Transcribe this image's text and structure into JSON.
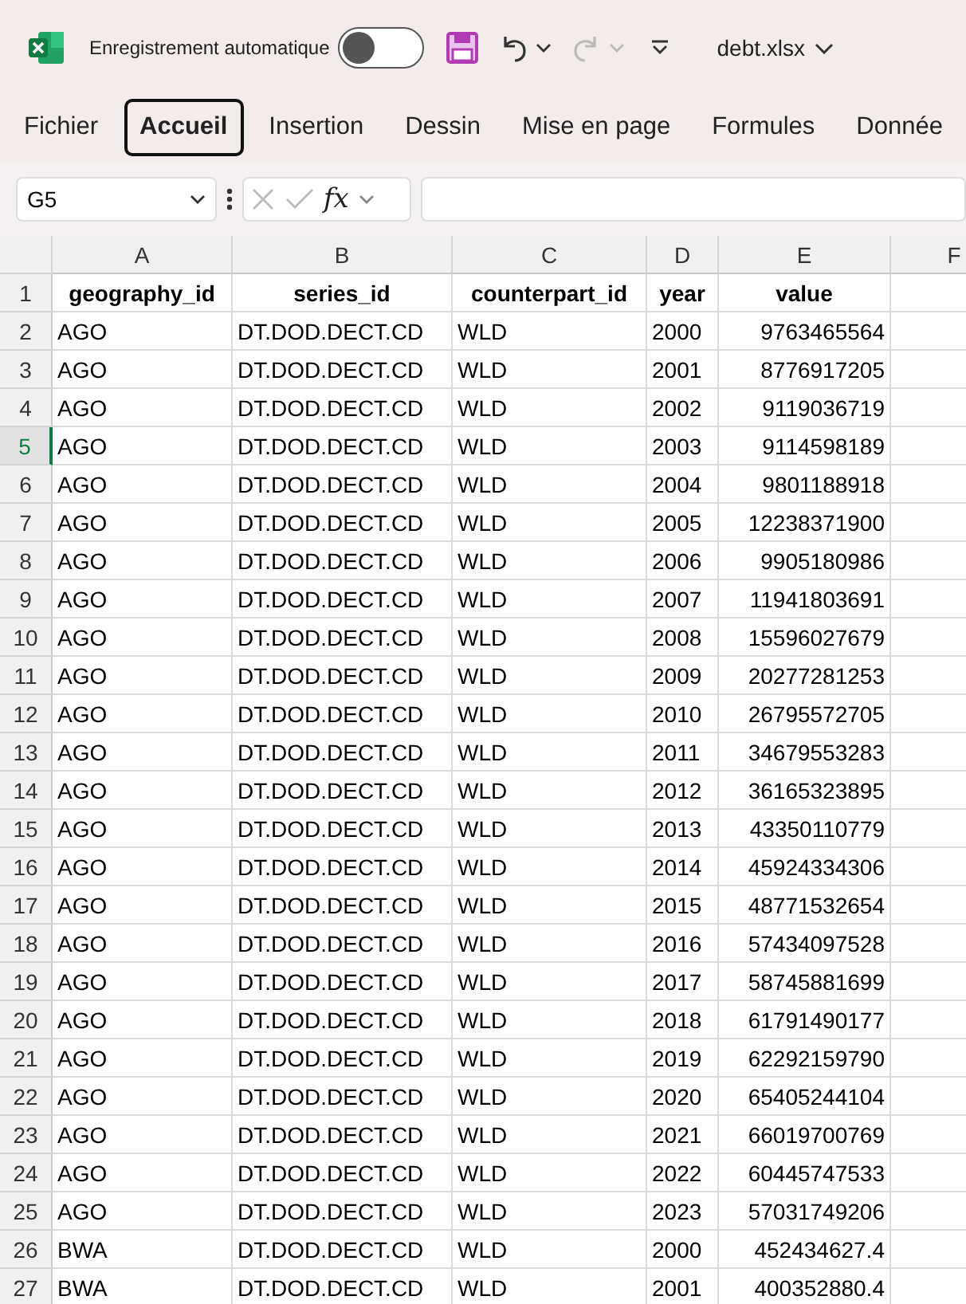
{
  "title_bar": {
    "autosave_label": "Enregistrement automatique",
    "autosave_on": false,
    "undo_disabled": false,
    "redo_disabled": true,
    "file_name": "debt.xlsx"
  },
  "ribbon_tabs": [
    {
      "label": "Fichier",
      "selected": false
    },
    {
      "label": "Accueil",
      "selected": true
    },
    {
      "label": "Insertion",
      "selected": false
    },
    {
      "label": "Dessin",
      "selected": false
    },
    {
      "label": "Mise en page",
      "selected": false
    },
    {
      "label": "Formules",
      "selected": false
    },
    {
      "label": "Donnée",
      "selected": false
    }
  ],
  "formula_bar": {
    "name_box": "G5",
    "fx": "fx"
  },
  "columns": [
    {
      "label": "A",
      "selected": false
    },
    {
      "label": "B",
      "selected": false
    },
    {
      "label": "C",
      "selected": false
    },
    {
      "label": "D",
      "selected": false
    },
    {
      "label": "E",
      "selected": false
    },
    {
      "label": "F",
      "selected": false
    }
  ],
  "rows": [
    {
      "number": "1",
      "kind": "header",
      "selected": false,
      "cells": [
        "geography_id",
        "series_id",
        "counterpart_id",
        "year",
        "value"
      ]
    },
    {
      "number": "2",
      "kind": "data",
      "selected": false,
      "cells": [
        "AGO",
        "DT.DOD.DECT.CD",
        "WLD",
        "2000",
        "9763465564"
      ]
    },
    {
      "number": "3",
      "kind": "data",
      "selected": false,
      "cells": [
        "AGO",
        "DT.DOD.DECT.CD",
        "WLD",
        "2001",
        "8776917205"
      ]
    },
    {
      "number": "4",
      "kind": "data",
      "selected": false,
      "cells": [
        "AGO",
        "DT.DOD.DECT.CD",
        "WLD",
        "2002",
        "9119036719"
      ]
    },
    {
      "number": "5",
      "kind": "data",
      "selected": true,
      "cells": [
        "AGO",
        "DT.DOD.DECT.CD",
        "WLD",
        "2003",
        "9114598189"
      ]
    },
    {
      "number": "6",
      "kind": "data",
      "selected": false,
      "cells": [
        "AGO",
        "DT.DOD.DECT.CD",
        "WLD",
        "2004",
        "9801188918"
      ]
    },
    {
      "number": "7",
      "kind": "data",
      "selected": false,
      "cells": [
        "AGO",
        "DT.DOD.DECT.CD",
        "WLD",
        "2005",
        "12238371900"
      ]
    },
    {
      "number": "8",
      "kind": "data",
      "selected": false,
      "cells": [
        "AGO",
        "DT.DOD.DECT.CD",
        "WLD",
        "2006",
        "9905180986"
      ]
    },
    {
      "number": "9",
      "kind": "data",
      "selected": false,
      "cells": [
        "AGO",
        "DT.DOD.DECT.CD",
        "WLD",
        "2007",
        "11941803691"
      ]
    },
    {
      "number": "10",
      "kind": "data",
      "selected": false,
      "cells": [
        "AGO",
        "DT.DOD.DECT.CD",
        "WLD",
        "2008",
        "15596027679"
      ]
    },
    {
      "number": "11",
      "kind": "data",
      "selected": false,
      "cells": [
        "AGO",
        "DT.DOD.DECT.CD",
        "WLD",
        "2009",
        "20277281253"
      ]
    },
    {
      "number": "12",
      "kind": "data",
      "selected": false,
      "cells": [
        "AGO",
        "DT.DOD.DECT.CD",
        "WLD",
        "2010",
        "26795572705"
      ]
    },
    {
      "number": "13",
      "kind": "data",
      "selected": false,
      "cells": [
        "AGO",
        "DT.DOD.DECT.CD",
        "WLD",
        "2011",
        "34679553283"
      ]
    },
    {
      "number": "14",
      "kind": "data",
      "selected": false,
      "cells": [
        "AGO",
        "DT.DOD.DECT.CD",
        "WLD",
        "2012",
        "36165323895"
      ]
    },
    {
      "number": "15",
      "kind": "data",
      "selected": false,
      "cells": [
        "AGO",
        "DT.DOD.DECT.CD",
        "WLD",
        "2013",
        "43350110779"
      ]
    },
    {
      "number": "16",
      "kind": "data",
      "selected": false,
      "cells": [
        "AGO",
        "DT.DOD.DECT.CD",
        "WLD",
        "2014",
        "45924334306"
      ]
    },
    {
      "number": "17",
      "kind": "data",
      "selected": false,
      "cells": [
        "AGO",
        "DT.DOD.DECT.CD",
        "WLD",
        "2015",
        "48771532654"
      ]
    },
    {
      "number": "18",
      "kind": "data",
      "selected": false,
      "cells": [
        "AGO",
        "DT.DOD.DECT.CD",
        "WLD",
        "2016",
        "57434097528"
      ]
    },
    {
      "number": "19",
      "kind": "data",
      "selected": false,
      "cells": [
        "AGO",
        "DT.DOD.DECT.CD",
        "WLD",
        "2017",
        "58745881699"
      ]
    },
    {
      "number": "20",
      "kind": "data",
      "selected": false,
      "cells": [
        "AGO",
        "DT.DOD.DECT.CD",
        "WLD",
        "2018",
        "61791490177"
      ]
    },
    {
      "number": "21",
      "kind": "data",
      "selected": false,
      "cells": [
        "AGO",
        "DT.DOD.DECT.CD",
        "WLD",
        "2019",
        "62292159790"
      ]
    },
    {
      "number": "22",
      "kind": "data",
      "selected": false,
      "cells": [
        "AGO",
        "DT.DOD.DECT.CD",
        "WLD",
        "2020",
        "65405244104"
      ]
    },
    {
      "number": "23",
      "kind": "data",
      "selected": false,
      "cells": [
        "AGO",
        "DT.DOD.DECT.CD",
        "WLD",
        "2021",
        "66019700769"
      ]
    },
    {
      "number": "24",
      "kind": "data",
      "selected": false,
      "cells": [
        "AGO",
        "DT.DOD.DECT.CD",
        "WLD",
        "2022",
        "60445747533"
      ]
    },
    {
      "number": "25",
      "kind": "data",
      "selected": false,
      "cells": [
        "AGO",
        "DT.DOD.DECT.CD",
        "WLD",
        "2023",
        "57031749206"
      ]
    },
    {
      "number": "26",
      "kind": "data",
      "selected": false,
      "cells": [
        "BWA",
        "DT.DOD.DECT.CD",
        "WLD",
        "2000",
        "452434627.4"
      ]
    },
    {
      "number": "27",
      "kind": "data",
      "selected": false,
      "cells": [
        "BWA",
        "DT.DOD.DECT.CD",
        "WLD",
        "2001",
        "400352880.4"
      ]
    }
  ]
}
